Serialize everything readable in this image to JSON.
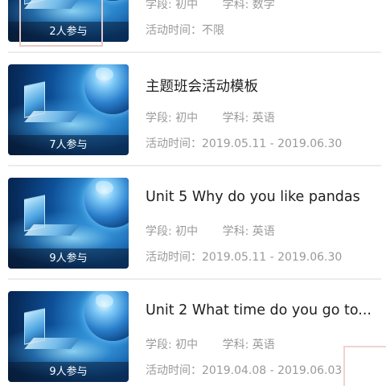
{
  "activities": [
    {
      "title": "",
      "participants": "2人参与",
      "stage": "学段: 初中",
      "subject": "学科: 数学",
      "time": "活动时间：不限"
    },
    {
      "title": "主题班会活动模板",
      "participants": "7人参与",
      "stage": "学段: 初中",
      "subject": "学科: 英语",
      "time": "活动时间：2019.05.11 - 2019.06.30"
    },
    {
      "title": "Unit 5  Why do you like pandas",
      "participants": "9人参与",
      "stage": "学段: 初中",
      "subject": "学科: 英语",
      "time": "活动时间：2019.05.11 - 2019.06.30"
    },
    {
      "title": "Unit 2  What time do you go to...",
      "participants": "9人参与",
      "stage": "学段: 初中",
      "subject": "学科: 英语",
      "time": "活动时间：2019.04.08 - 2019.06.03"
    }
  ]
}
